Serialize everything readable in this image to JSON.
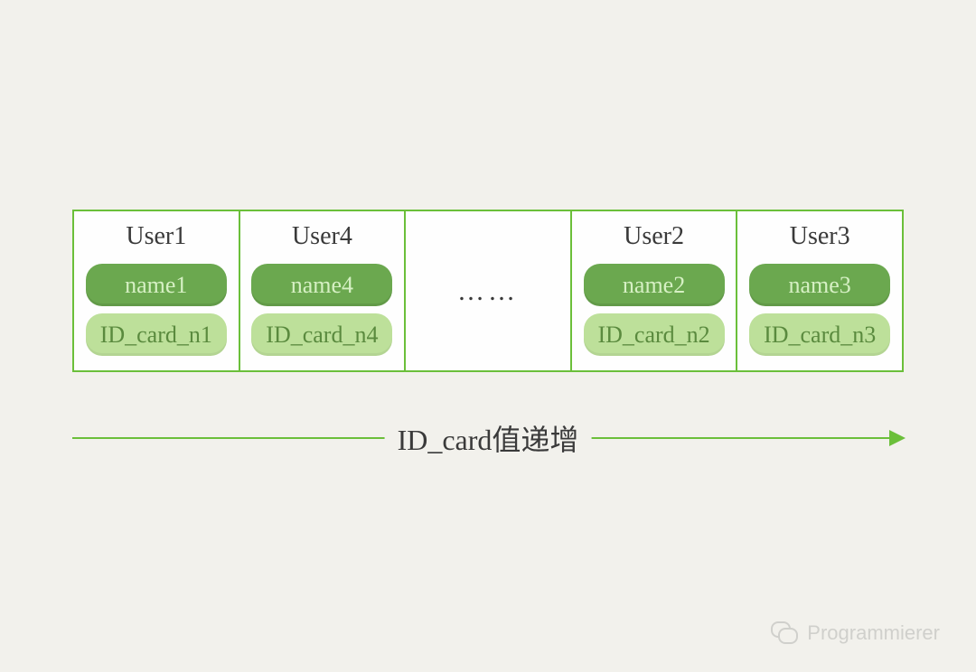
{
  "cells": [
    {
      "title": "User1",
      "name": "name1",
      "id": "ID_card_n1",
      "type": "data"
    },
    {
      "title": "User4",
      "name": "name4",
      "id": "ID_card_n4",
      "type": "data"
    },
    {
      "ellipsis": "……",
      "type": "ellipsis"
    },
    {
      "title": "User2",
      "name": "name2",
      "id": "ID_card_n2",
      "type": "data"
    },
    {
      "title": "User3",
      "name": "name3",
      "id": "ID_card_n3",
      "type": "data"
    }
  ],
  "arrow_label": "ID_card值递增",
  "watermark": "Programmierer",
  "colors": {
    "background": "#f2f1ec",
    "border": "#6bbf3a",
    "pill_name_bg": "#6ba84f",
    "pill_name_fg": "#d6f0c4",
    "pill_id_bg": "#bde09a",
    "pill_id_fg": "#5a8a3e"
  }
}
